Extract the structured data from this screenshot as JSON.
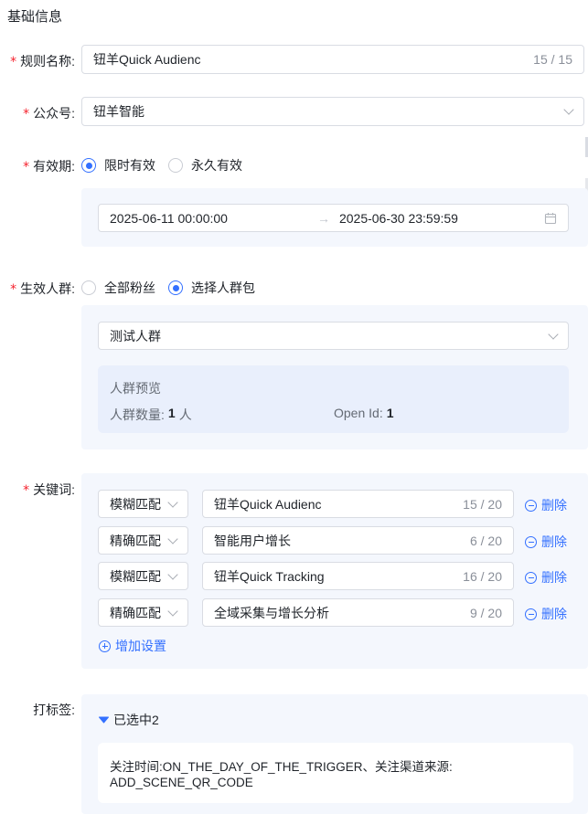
{
  "section_title": "基础信息",
  "rule_name": {
    "label": "规则名称:",
    "value": "钮羊Quick Audienc",
    "count": "15 / 15"
  },
  "official_account": {
    "label": "公众号:",
    "value": "钮羊智能"
  },
  "validity": {
    "label": "有效期:",
    "options": [
      "限时有效",
      "永久有效"
    ],
    "selected": "限时有效",
    "start": "2025-06-11 00:00:00",
    "end": "2025-06-30 23:59:59",
    "separator": "→"
  },
  "audience": {
    "label": "生效人群:",
    "options": [
      "全部粉丝",
      "选择人群包"
    ],
    "selected": "选择人群包",
    "package": "测试人群",
    "preview_title": "人群预览",
    "count_label": "人群数量:",
    "count_value": "1",
    "count_unit": "人",
    "openid_label": "Open Id:",
    "openid_value": "1"
  },
  "keywords": {
    "label": "关键词:",
    "delete_label": "删除",
    "add_label": "增加设置",
    "rows": [
      {
        "match": "模糊匹配",
        "text": "钮羊Quick Audienc",
        "count": "15 / 20"
      },
      {
        "match": "精确匹配",
        "text": "智能用户增长",
        "count": "6 / 20"
      },
      {
        "match": "模糊匹配",
        "text": "钮羊Quick Tracking",
        "count": "16 / 20"
      },
      {
        "match": "精确匹配",
        "text": "全域采集与增长分析",
        "count": "9 / 20"
      }
    ]
  },
  "tagging": {
    "label": "打标签:",
    "selected_text": "已选中2",
    "detail_line1": "关注时间:ON_THE_DAY_OF_THE_TRIGGER、关注渠道来源:",
    "detail_line2": "ADD_SCENE_QR_CODE"
  },
  "colors": {
    "accent": "#3370ff",
    "required": "#f5222d",
    "panel": "#f4f7fd"
  },
  "icons": [
    "chevron-down-icon",
    "calendar-icon",
    "arrow-right-icon",
    "minus-circle-icon",
    "plus-circle-icon",
    "caret-down-icon"
  ]
}
